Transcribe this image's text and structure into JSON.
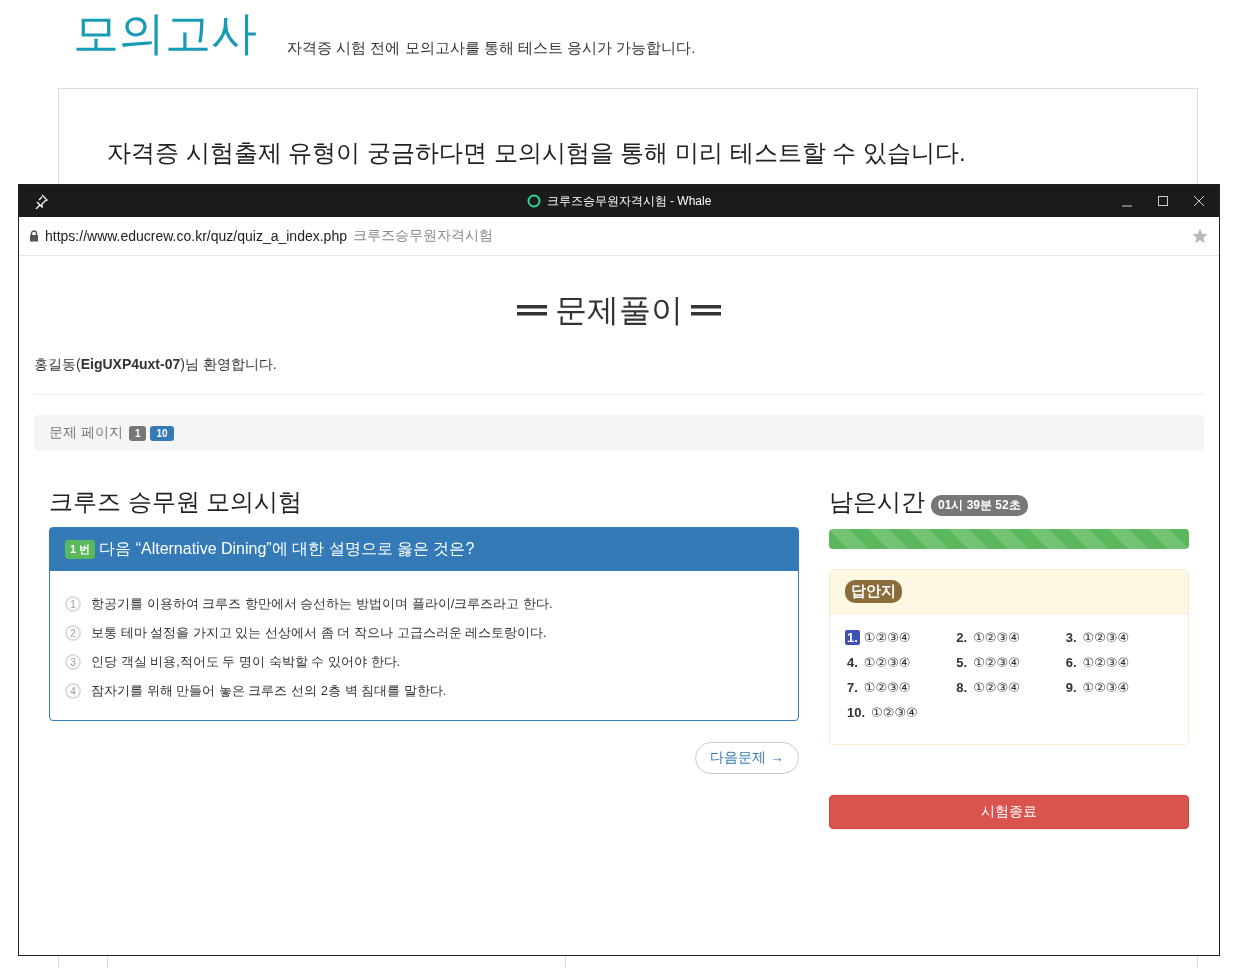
{
  "page": {
    "title": "모의고사",
    "subtitle": "자격증 시험 전에 모의고사를 통해 테스트 응시가 가능합니다.",
    "lead": "자격증 시험출제 유형이 궁금하다면 모의시험을 통해 미리 테스트할 수 있습니다."
  },
  "window": {
    "title": "크루즈승무원자격시험 - Whale",
    "url": "https://www.educrew.co.kr/quz/quiz_a_index.php",
    "url_title": "크루즈승무원자격시험"
  },
  "content": {
    "heading": "문제풀이",
    "welcome": "홍길동(**EigUXP4uxt-07**)님 환영합니다.",
    "page_label": "문제 페이지",
    "page_current": "1",
    "page_total": "10",
    "exam_title": "크루즈 승무원 모의시험",
    "question": {
      "badge": "1 번",
      "text": "다음 “Alternative Dining”에 대한 설명으로 옳은 것은?",
      "options": [
        {
          "num": "1",
          "text": "항공기를 이용하여 크루즈 항만에서 승선하는 방법이며 플라이/크루즈라고 한다."
        },
        {
          "num": "2",
          "text": "보통 테마 설정을 가지고 있는 선상에서 좀 더 작으나 고급스러운 레스토랑이다."
        },
        {
          "num": "3",
          "text": "인당 객실 비용,적어도 두 명이 숙박할 수 있어야 한다."
        },
        {
          "num": "4",
          "text": "잠자기를 위해 만들어 놓은 크루즈 선의 2층 벽 침대를 말한다."
        }
      ]
    },
    "next_button": "다음문제 →",
    "timer": {
      "label": "남은시간",
      "value": "01시 39분 52초",
      "level": 1.0
    },
    "answer_sheet": {
      "title": "답안지",
      "items": [
        {
          "num": "1.",
          "marks": "①②③④",
          "selected": true
        },
        {
          "num": "2.",
          "marks": "①②③④",
          "selected": false
        },
        {
          "num": "3.",
          "marks": "①②③④",
          "selected": false
        },
        {
          "num": "4.",
          "marks": "①②③④",
          "selected": false
        },
        {
          "num": "5.",
          "marks": "①②③④",
          "selected": false
        },
        {
          "num": "6.",
          "marks": "①②③④",
          "selected": false
        },
        {
          "num": "7.",
          "marks": "①②③④",
          "selected": false
        },
        {
          "num": "8.",
          "marks": "①②③④",
          "selected": false
        },
        {
          "num": "9.",
          "marks": "①②③④",
          "selected": false
        },
        {
          "num": "10.",
          "marks": "①②③④",
          "selected": false
        }
      ]
    },
    "end_button": "시험종료"
  }
}
